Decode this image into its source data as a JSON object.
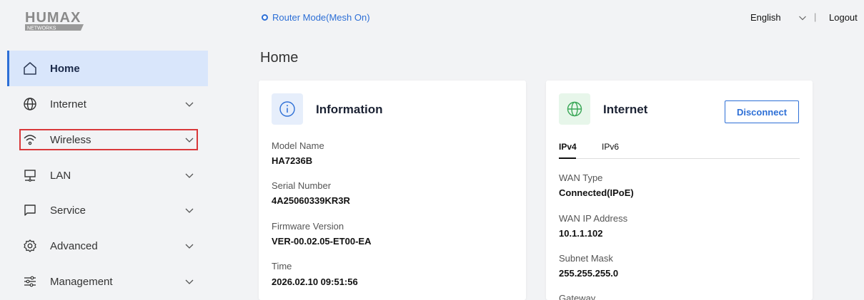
{
  "brand": {
    "name": "HUMAX",
    "sub": "NETWORKS"
  },
  "header": {
    "mode": "Router Mode(Mesh On)",
    "language": "English",
    "separator": "|",
    "logout": "Logout"
  },
  "sidebar": {
    "items": [
      {
        "label": "Home",
        "icon": "home-icon",
        "active": true
      },
      {
        "label": "Internet",
        "icon": "globe-icon"
      },
      {
        "label": "Wireless",
        "icon": "wifi-icon",
        "highlighted": true
      },
      {
        "label": "LAN",
        "icon": "lan-icon"
      },
      {
        "label": "Service",
        "icon": "service-icon"
      },
      {
        "label": "Advanced",
        "icon": "gear-icon"
      },
      {
        "label": "Management",
        "icon": "sliders-icon"
      }
    ]
  },
  "page": {
    "title": "Home"
  },
  "info_card": {
    "title": "Information",
    "fields": [
      {
        "label": "Model Name",
        "value": "HA7236B"
      },
      {
        "label": "Serial Number",
        "value": "4A25060339KR3R"
      },
      {
        "label": "Firmware Version",
        "value": "VER-00.02.05-ET00-EA"
      },
      {
        "label": "Time",
        "value": "2026.02.10 09:51:56"
      }
    ]
  },
  "internet_card": {
    "title": "Internet",
    "button": "Disconnect",
    "tabs": [
      "IPv4",
      "IPv6"
    ],
    "fields": [
      {
        "label": "WAN Type",
        "value": "Connected(IPoE)"
      },
      {
        "label": "WAN IP Address",
        "value": "10.1.1.102"
      },
      {
        "label": "Subnet Mask",
        "value": "255.255.255.0"
      },
      {
        "label": "Gateway",
        "value": ""
      }
    ]
  },
  "colors": {
    "accent": "#2d6fd6",
    "active_bg": "#d9e6fb",
    "highlight_border": "#d9383a"
  }
}
